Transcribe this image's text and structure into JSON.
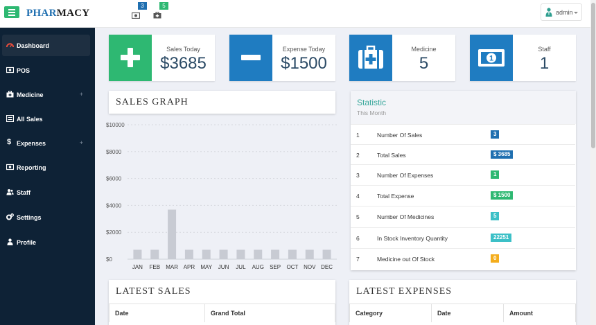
{
  "header": {
    "brand_part1": "PHAR",
    "brand_part2": "MACY",
    "notifications": [
      {
        "icon": "money-icon",
        "count": "3",
        "color": "#1f6fb0"
      },
      {
        "icon": "medkit-icon",
        "count": "5",
        "color": "#2eb872"
      }
    ],
    "user": {
      "label": "admin"
    }
  },
  "sidebar": {
    "items": [
      {
        "label": "Dashboard",
        "icon": "dashboard-icon",
        "active": true,
        "expandable": false
      },
      {
        "label": "POS",
        "icon": "money-icon",
        "active": false,
        "expandable": false
      },
      {
        "label": "Medicine",
        "icon": "medkit-icon",
        "active": false,
        "expandable": true
      },
      {
        "label": "All Sales",
        "icon": "list-icon",
        "active": false,
        "expandable": false
      },
      {
        "label": "Expenses",
        "icon": "dollar-icon",
        "active": false,
        "expandable": true
      },
      {
        "label": "Reporting",
        "icon": "money-icon",
        "active": false,
        "expandable": false
      },
      {
        "label": "Staff",
        "icon": "users-icon",
        "active": false,
        "expandable": false
      },
      {
        "label": "Settings",
        "icon": "cogs-icon",
        "active": false,
        "expandable": false
      },
      {
        "label": "Profile",
        "icon": "user-icon",
        "active": false,
        "expandable": false
      }
    ],
    "plus_symbol": "+"
  },
  "cards": [
    {
      "label": "Sales Today",
      "value": "$3685",
      "color": "#2eb872",
      "icon": "plus-icon"
    },
    {
      "label": "Expense Today",
      "value": "$1500",
      "color": "#1f7cc1",
      "icon": "minus-icon"
    },
    {
      "label": "Medicine",
      "value": "5",
      "color": "#1f7cc1",
      "icon": "medkit-icon"
    },
    {
      "label": "Staff",
      "value": "1",
      "color": "#1f7cc1",
      "icon": "money-bill-icon"
    }
  ],
  "sales_graph": {
    "title": "SALES GRAPH"
  },
  "chart_data": {
    "type": "bar",
    "categories": [
      "JAN",
      "FEB",
      "MAR",
      "APR",
      "MAY",
      "JUN",
      "JUL",
      "AUG",
      "SEP",
      "OCT",
      "NOV",
      "DEC"
    ],
    "values": [
      700,
      700,
      3685,
      700,
      700,
      700,
      700,
      700,
      700,
      700,
      700,
      700
    ],
    "yticks": [
      "$0",
      "$2000",
      "$4000",
      "$6000",
      "$8000",
      "$10000"
    ],
    "ylim": [
      0,
      10000
    ],
    "bar_color": "#c8cbd3",
    "grid": true
  },
  "statistic": {
    "title": "Statistic",
    "subtitle": "This Month",
    "rows": [
      {
        "n": "1",
        "label": "Number Of Sales",
        "value": "3",
        "color": "#1f6fb0"
      },
      {
        "n": "2",
        "label": "Total Sales",
        "value": "$ 3685",
        "color": "#1f6fb0"
      },
      {
        "n": "3",
        "label": "Number Of Expenses",
        "value": "1",
        "color": "#2eb872"
      },
      {
        "n": "4",
        "label": "Total Expense",
        "value": "$ 1500",
        "color": "#2eb872"
      },
      {
        "n": "5",
        "label": "Number Of Medicines",
        "value": "5",
        "color": "#3cc0c7"
      },
      {
        "n": "6",
        "label": "In Stock Inventory Quantity",
        "value": "22251",
        "color": "#3cc0c7"
      },
      {
        "n": "7",
        "label": "Medicine out Of Stock",
        "value": "0",
        "color": "#f4ad1c"
      }
    ]
  },
  "latest_sales": {
    "title": "LATEST SALES",
    "columns": [
      "Date",
      "Grand Total"
    ]
  },
  "latest_expenses": {
    "title": "LATEST EXPENSES",
    "columns": [
      "Category",
      "Date",
      "Amount"
    ]
  }
}
